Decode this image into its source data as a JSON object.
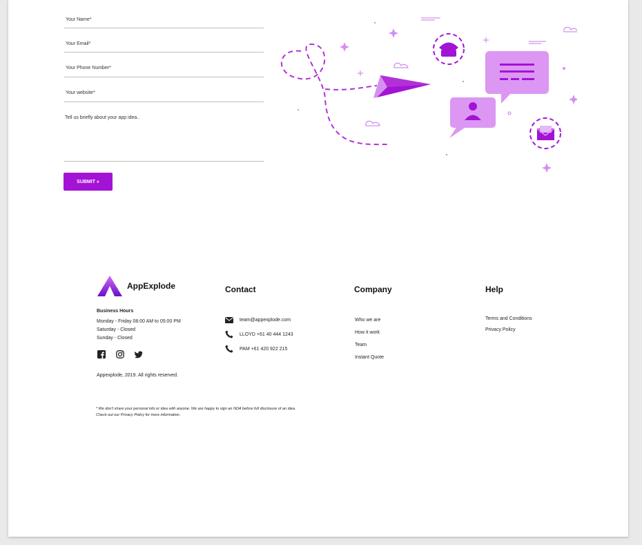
{
  "form": {
    "name_placeholder": "Your Name*",
    "email_placeholder": "Your Email*",
    "phone_placeholder": "Your Phone Number*",
    "website_placeholder": "Your website*",
    "idea_placeholder": "Tell us briefly about your app idea..",
    "submit_label": "SUBMIT »"
  },
  "brand": {
    "name": "AppExplode",
    "accent": "#a313d6"
  },
  "business_hours": {
    "title": "Business Hours",
    "lines": [
      "Monday - Friday 08:00 AM to 05:00 PM",
      "Saturday - Closed",
      "Sunday - Closed"
    ]
  },
  "social": [
    "facebook-icon",
    "instagram-icon",
    "twitter-icon"
  ],
  "copyright": "Appexplode, 2019. All rights reserved.",
  "disclaimer": "* We don't share your personal info or idea with anyone. We are happy to sign an NDA before full disclosure of an idea. Check out our Privacy Policy for more information.",
  "contact": {
    "title": "Contact",
    "email": "team@appexplode.com",
    "phone1": "LLOYD +61 40 444 1243",
    "phone2": "PAM +61 420 922 215"
  },
  "company": {
    "title": "Company",
    "links": [
      "Who we are",
      "How it work",
      "Team",
      "Instant Quote"
    ]
  },
  "help": {
    "title": "Help",
    "links": [
      "Terms and Conditions",
      "Privacy Policy"
    ]
  }
}
